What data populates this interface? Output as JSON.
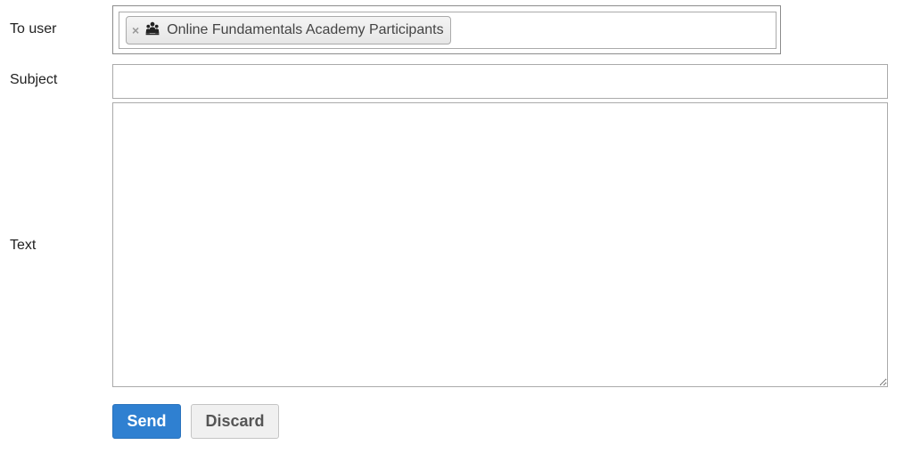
{
  "form": {
    "to_label": "To user",
    "subject_label": "Subject",
    "text_label": "Text",
    "recipient_token": {
      "remove_symbol": "×",
      "icon": "group-users-icon",
      "label": "Online Fundamentals Academy Participants"
    },
    "subject_value": "",
    "text_value": ""
  },
  "actions": {
    "send_label": "Send",
    "discard_label": "Discard"
  },
  "colors": {
    "send_button": "#2f80d1",
    "discard_button": "#f0f0f0"
  }
}
